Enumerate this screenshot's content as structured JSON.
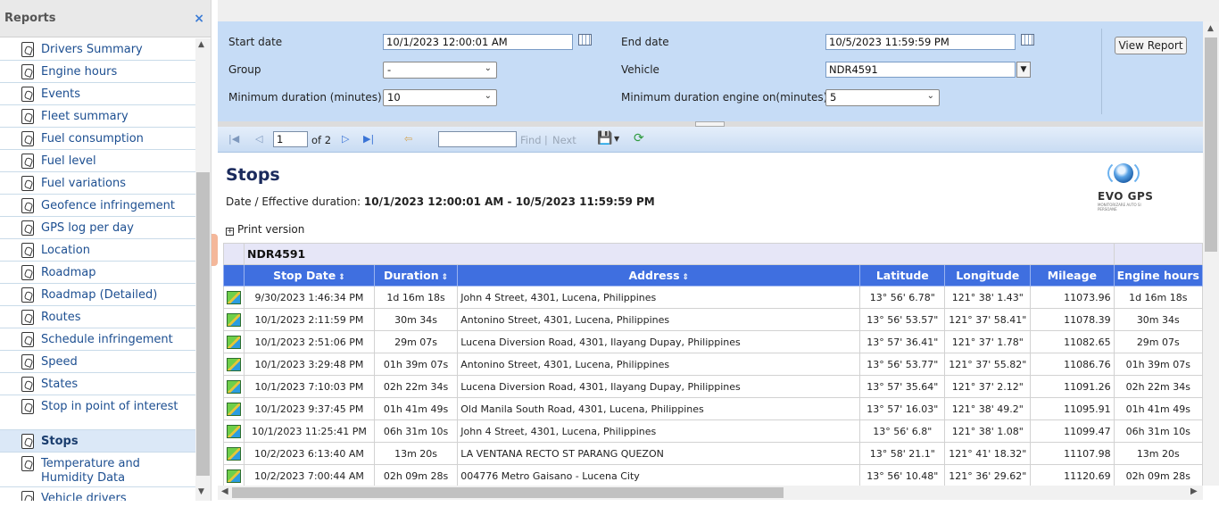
{
  "sidebar": {
    "title": "Reports",
    "close_icon": "×",
    "items": [
      {
        "label": "Drivers Summary"
      },
      {
        "label": "Engine hours"
      },
      {
        "label": "Events"
      },
      {
        "label": "Fleet summary"
      },
      {
        "label": "Fuel consumption"
      },
      {
        "label": "Fuel level"
      },
      {
        "label": "Fuel variations"
      },
      {
        "label": "Geofence infringement"
      },
      {
        "label": "GPS log per day"
      },
      {
        "label": "Location"
      },
      {
        "label": "Roadmap"
      },
      {
        "label": "Roadmap (Detailed)"
      },
      {
        "label": "Routes"
      },
      {
        "label": "Schedule infringement"
      },
      {
        "label": "Speed"
      },
      {
        "label": "States"
      },
      {
        "label": "Stop in point of interest"
      },
      {
        "label": "Stops",
        "selected": true
      },
      {
        "label": "Temperature and Humidity Data"
      },
      {
        "label": "Vehicle drivers"
      }
    ]
  },
  "params": {
    "start_date_label": "Start date",
    "start_date_value": "10/1/2023 12:00:01 AM",
    "end_date_label": "End date",
    "end_date_value": "10/5/2023 11:59:59 PM",
    "group_label": "Group",
    "group_value": "-",
    "vehicle_label": "Vehicle",
    "vehicle_value": "NDR4591",
    "min_duration_label": "Minimum duration (minutes)",
    "min_duration_value": "10",
    "min_engine_label": "Minimum duration engine on(minutes)",
    "min_engine_value": "5",
    "view_report": "View Report"
  },
  "toolbar": {
    "page_value": "1",
    "of_pages": "of 2",
    "find": "Find",
    "separator": "|",
    "next": "Next"
  },
  "report": {
    "title": "Stops",
    "date_prefix": "Date / Effective duration: ",
    "date_range": "10/1/2023 12:00:01 AM - 10/5/2023 11:59:59 PM",
    "print_version": "Print version",
    "logo_text": "EVO GPS",
    "logo_tagline": "MONITORIZARE AUTO SI PERSOANE",
    "vehicle": "NDR4591",
    "columns": [
      "Stop Date",
      "Duration",
      "Address",
      "Latitude",
      "Longitude",
      "Mileage",
      "Engine hours"
    ],
    "rows": [
      {
        "date": "9/30/2023 1:46:34 PM",
        "duration": "1d 16m 18s",
        "address": "John 4 Street,  4301, Lucena,  Philippines",
        "lat": "13° 56' 6.78\"",
        "lon": "121° 38' 1.43\"",
        "mileage": "11073.96",
        "engine": "1d 16m 18s"
      },
      {
        "date": "10/1/2023 2:11:59 PM",
        "duration": "30m 34s",
        "address": "Antonino Street,  4301, Lucena,  Philippines",
        "lat": "13° 56' 53.57\"",
        "lon": "121° 37' 58.41\"",
        "mileage": "11078.39",
        "engine": "30m 34s"
      },
      {
        "date": "10/1/2023 2:51:06 PM",
        "duration": "29m 07s",
        "address": "Lucena Diversion Road,  4301, Ilayang Dupay,  Philippines",
        "lat": "13° 57' 36.41\"",
        "lon": "121° 37' 1.78\"",
        "mileage": "11082.65",
        "engine": "29m 07s"
      },
      {
        "date": "10/1/2023 3:29:48 PM",
        "duration": "01h 39m 07s",
        "address": "Antonino Street,  4301, Lucena,  Philippines",
        "lat": "13° 56' 53.77\"",
        "lon": "121° 37' 55.82\"",
        "mileage": "11086.76",
        "engine": "01h 39m 07s"
      },
      {
        "date": "10/1/2023 7:10:03 PM",
        "duration": "02h 22m 34s",
        "address": "Lucena Diversion Road,  4301, Ilayang Dupay,  Philippines",
        "lat": "13° 57' 35.64\"",
        "lon": "121° 37' 2.12\"",
        "mileage": "11091.26",
        "engine": "02h 22m 34s"
      },
      {
        "date": "10/1/2023 9:37:45 PM",
        "duration": "01h 41m 49s",
        "address": "Old Manila South Road,  4301, Lucena,  Philippines",
        "lat": "13° 57' 16.03\"",
        "lon": "121° 38' 49.2\"",
        "mileage": "11095.91",
        "engine": "01h 41m 49s"
      },
      {
        "date": "10/1/2023 11:25:41 PM",
        "duration": "06h 31m 10s",
        "address": "John 4 Street,  4301, Lucena,  Philippines",
        "lat": "13° 56' 6.8\"",
        "lon": "121° 38' 1.08\"",
        "mileage": "11099.47",
        "engine": "06h 31m 10s"
      },
      {
        "date": "10/2/2023 6:13:40 AM",
        "duration": "13m 20s",
        "address": "LA VENTANA RECTO ST PARANG QUEZON",
        "lat": "13° 58' 21.1\"",
        "lon": "121° 41' 18.32\"",
        "mileage": "11107.98",
        "engine": "13m 20s"
      },
      {
        "date": "10/2/2023 7:00:44 AM",
        "duration": "02h 09m 28s",
        "address": "004776 Metro Gaisano - Lucena City",
        "lat": "13° 56' 10.48\"",
        "lon": "121° 36' 29.62\"",
        "mileage": "11120.69",
        "engine": "02h 09m 28s"
      }
    ]
  }
}
